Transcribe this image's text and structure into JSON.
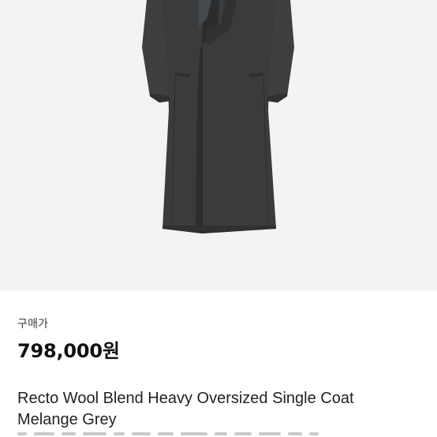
{
  "product": {
    "image_alt": "Recto Wool Blend Heavy Oversized Single Coat Melange Grey",
    "price_label": "구매가",
    "price": "798,000원",
    "title_line1": "Recto Wool Blend Heavy Oversized Single Coat",
    "title_line2": "Melange Grey"
  },
  "colors": {
    "image_background": "#f3f3f2",
    "coat": "#3a3c3e",
    "text_primary": "#111111"
  }
}
